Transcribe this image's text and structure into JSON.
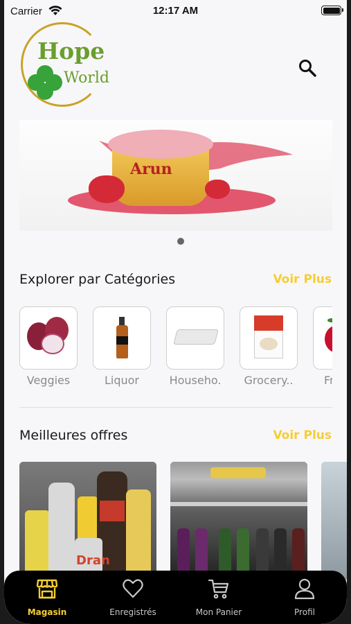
{
  "status_bar": {
    "carrier": "Carrier",
    "time": "12:17 AM"
  },
  "logo": {
    "line1": "Hope",
    "line2": "World"
  },
  "banner": {
    "brand": "Arun",
    "slide_count": 1,
    "active_slide": 1
  },
  "categories_section": {
    "title": "Explorer par Catégories",
    "see_more": "Voir Plus",
    "items": [
      {
        "label": "Veggies",
        "icon": "onion-image"
      },
      {
        "label": "Liquor",
        "icon": "whisky-bottle-image"
      },
      {
        "label": "Househo.",
        "icon": "mattress-image"
      },
      {
        "label": "Grocery..",
        "icon": "rice-box-image"
      },
      {
        "label": "Fr",
        "icon": "apple-image"
      }
    ]
  },
  "offers_section": {
    "title": "Meilleures offres",
    "see_more": "Voir Plus",
    "items": [
      {
        "image": "cleaning-products-image",
        "brand_text": "Dran"
      },
      {
        "image": "drinks-fridge-image"
      },
      {
        "image": "partial-offer-image"
      }
    ]
  },
  "tab_bar": {
    "active_color": "#f6cd32",
    "tabs": [
      {
        "label": "Magasin",
        "icon": "store-icon",
        "active": true
      },
      {
        "label": "Enregistrés",
        "icon": "heart-icon",
        "active": false
      },
      {
        "label": "Mon Panier",
        "icon": "cart-icon",
        "active": false
      },
      {
        "label": "Profil",
        "icon": "user-icon",
        "active": false
      }
    ]
  }
}
